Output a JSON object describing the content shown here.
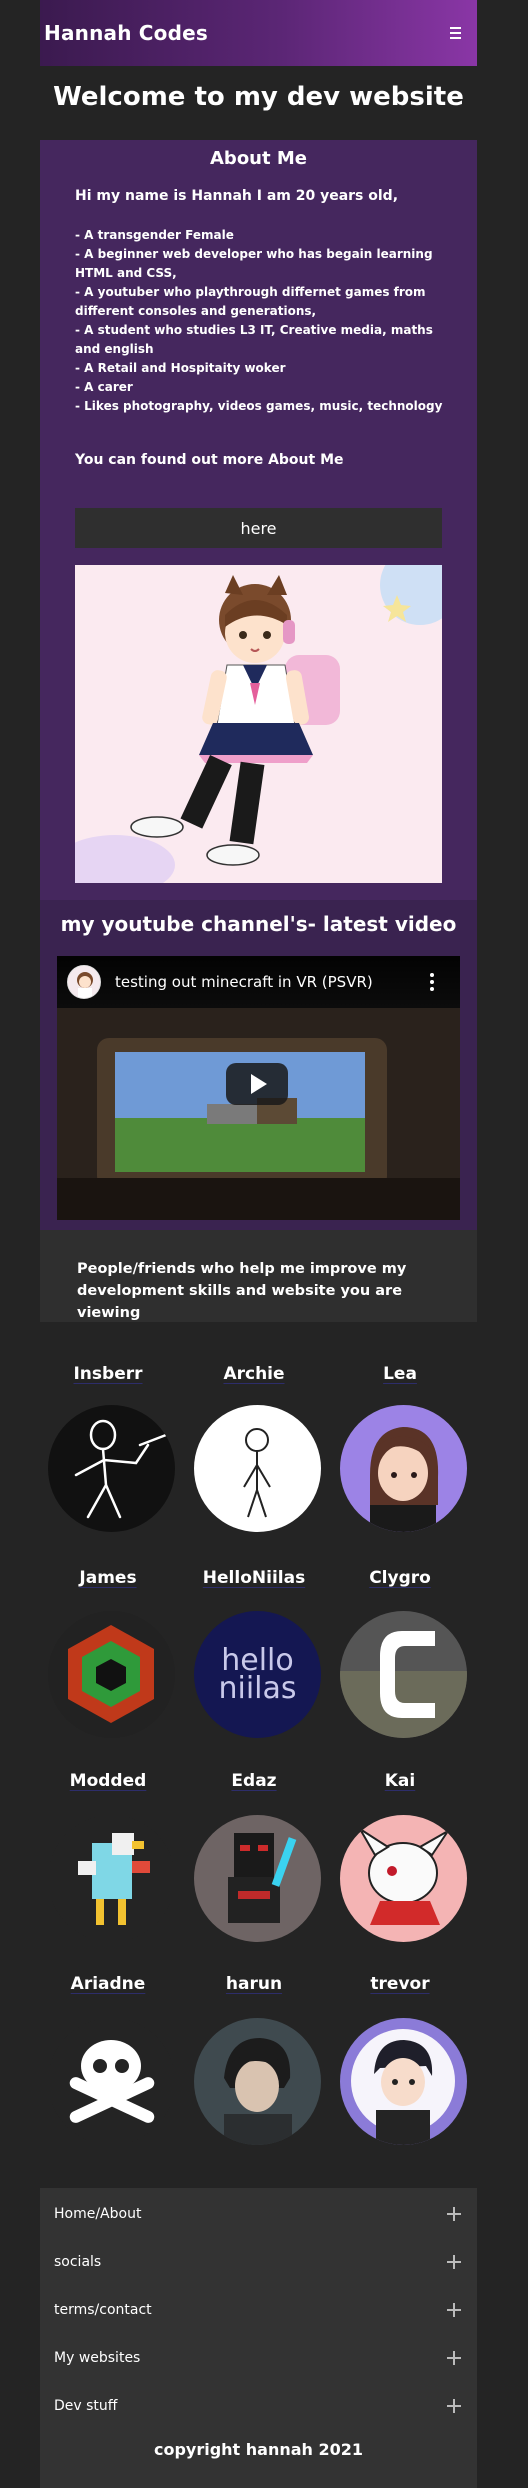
{
  "header": {
    "brand": "Hannah Codes",
    "menu_icon": "hamburger-icon"
  },
  "welcome": "Welcome to my dev website",
  "about": {
    "title": "About Me",
    "intro": "Hi my name is Hannah I am 20 years old,",
    "bullets": [
      "- A transgender Female",
      "- A beginner web developer who has begain learning HTML and CSS,",
      "- A youtuber who playthrough differnet games from different consoles and generations,",
      "- A student who studies L3 IT, Creative media, maths and english",
      "- A Retail and Hospitaity woker",
      "- A carer",
      "- Likes photography, videos games, music, technology"
    ],
    "more_text": "You can found out more About Me",
    "here_button": "here"
  },
  "youtube": {
    "title": "my youtube channel's- latest video",
    "video_title": "testing out minecraft in VR (PSVR)"
  },
  "friends": {
    "intro": "People/friends who help me improve my development skills and website you are viewing",
    "list": [
      {
        "name": "Insberr"
      },
      {
        "name": "Archie"
      },
      {
        "name": "Lea"
      },
      {
        "name": "James"
      },
      {
        "name": "HelloNiilas"
      },
      {
        "name": "Clygro"
      },
      {
        "name": "Modded"
      },
      {
        "name": "Edaz"
      },
      {
        "name": "Kai"
      },
      {
        "name": "Ariadne"
      },
      {
        "name": "harun"
      },
      {
        "name": "trevor"
      }
    ],
    "hello_logo_line1": "hello",
    "hello_logo_line2": "niilas"
  },
  "footer": {
    "items": [
      "Home/About",
      "socials",
      "terms/contact",
      "My websites",
      "Dev stuff"
    ],
    "copyright": "copyright hannah 2021"
  },
  "colors": {
    "accent": "#45275e",
    "header_end": "#8a36a6",
    "background": "#242424",
    "footer": "#333333"
  }
}
